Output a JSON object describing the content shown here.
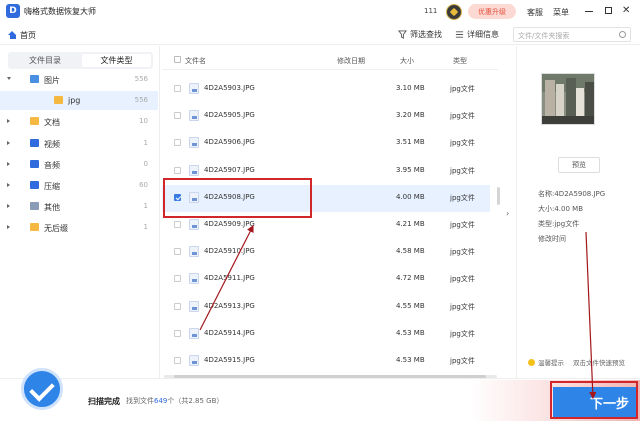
{
  "app": {
    "logo_letter": "D",
    "title": "嗨格式数据恢复大师",
    "user_count": "111",
    "vip_button": "优惠升级",
    "help": "客服",
    "menu": "菜单"
  },
  "subbar": {
    "home_tab": "首页",
    "filter": "筛选查找",
    "details": "详细信息",
    "search_placeholder": "文件/文件夹搜索"
  },
  "left_tabs": [
    "文件目录",
    "文件类型"
  ],
  "tree": [
    {
      "label": "图片",
      "count": "556",
      "color": "#4a90e2",
      "arrow": "down"
    },
    {
      "label": "jpg",
      "count": "556",
      "color": "#f5b942",
      "arrow": "none",
      "selected": true
    },
    {
      "label": "文档",
      "count": "10",
      "color": "#f5b942",
      "arrow": "right"
    },
    {
      "label": "视频",
      "count": "1",
      "color": "#2f6bdc",
      "arrow": "right"
    },
    {
      "label": "音频",
      "count": "0",
      "color": "#2f6bdc",
      "arrow": "right"
    },
    {
      "label": "压缩",
      "count": "60",
      "color": "#2f6bdc",
      "arrow": "right"
    },
    {
      "label": "其他",
      "count": "1",
      "color": "#8a9bb5",
      "arrow": "right"
    },
    {
      "label": "无后缀",
      "count": "1",
      "color": "#f5b942",
      "arrow": "right"
    }
  ],
  "list_header": {
    "name": "文件名",
    "modified": "修改日期",
    "size": "大小",
    "type": "类型"
  },
  "files": [
    {
      "name": "4D2A5903.JPG",
      "size": "3.10 MB",
      "type": "jpg文件",
      "checked": false
    },
    {
      "name": "4D2A5905.JPG",
      "size": "3.20 MB",
      "type": "jpg文件",
      "checked": false
    },
    {
      "name": "4D2A5906.JPG",
      "size": "3.51 MB",
      "type": "jpg文件",
      "checked": false
    },
    {
      "name": "4D2A5907.JPG",
      "size": "3.95 MB",
      "type": "jpg文件",
      "checked": false
    },
    {
      "name": "4D2A5908.JPG",
      "size": "4.00 MB",
      "type": "jpg文件",
      "checked": true
    },
    {
      "name": "4D2A5909.JPG",
      "size": "4.21 MB",
      "type": "jpg文件",
      "checked": false
    },
    {
      "name": "4D2A5910.JPG",
      "size": "4.58 MB",
      "type": "jpg文件",
      "checked": false
    },
    {
      "name": "4D2A5911.JPG",
      "size": "4.72 MB",
      "type": "jpg文件",
      "checked": false
    },
    {
      "name": "4D2A5913.JPG",
      "size": "4.55 MB",
      "type": "jpg文件",
      "checked": false
    },
    {
      "name": "4D2A5914.JPG",
      "size": "4.53 MB",
      "type": "jpg文件",
      "checked": false
    },
    {
      "name": "4D2A5915.JPG",
      "size": "4.53 MB",
      "type": "jpg文件",
      "checked": false
    }
  ],
  "detail": {
    "preview_button": "预览",
    "name_line": "名称:4D2A5908.JPG",
    "size_line": "大小:4.00 MB",
    "type_line": "类型:jpg文件",
    "mtime_line": "修改时间",
    "tip_label": "温馨提示",
    "tip_text": "双击文件快速预览"
  },
  "footer": {
    "status": "扫描完成",
    "found_prefix": "找到文件",
    "found_count": "649",
    "found_suffix": "个（共2.85 GB）",
    "next_button": "下一步"
  },
  "colors": {
    "accent": "#2f6bdc",
    "annotation_red": "#d1262a",
    "vip_bg": "#fdd9d3"
  }
}
